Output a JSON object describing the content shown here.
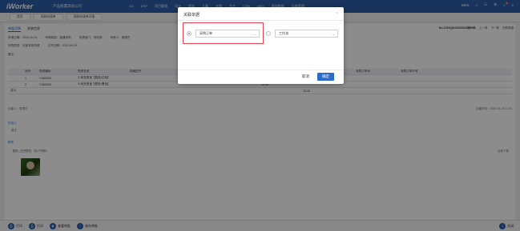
{
  "app": {
    "logo": "iWorker",
    "brand": "产品部署测试公司",
    "nav": [
      "OA",
      "ERP",
      "项目管理",
      "设计",
      "财务",
      "人事",
      "仓储",
      "生产",
      "CRM",
      "MES",
      "基础数据",
      "运维管理"
    ],
    "user": "MKS",
    "notif_count": "8"
  },
  "tabs": [
    "首页",
    "采购申请单",
    "采购申请单详情"
  ],
  "page": {
    "subtab_active": "单据详情",
    "subtab_other": "关联信息",
    "doc_no": "No.CGSQD202006250001",
    "tools": [
      "第一条",
      "上一条",
      "下一条",
      "关联单据"
    ],
    "form_rows": [
      [
        "申请日期：2020-06-25",
        "申请类型：普通采购",
        "申请部门：采购部",
        "申请人：管理员"
      ],
      [
        "采购类型：标准采购申请",
        "交货日期：2020-06-25"
      ],
      [
        "备注："
      ]
    ],
    "table": {
      "headers": [
        "",
        "序号",
        "物资编码",
        "物资名称",
        "规格型号",
        "数量",
        "单位",
        "备注",
        "采购订单号",
        "采购订单行号"
      ],
      "rows": [
        [
          "",
          "1",
          "CG60001",
          "小米充电宝【颜色:红色】",
          "",
          "",
          "5.00",
          "",
          "",
          ""
        ],
        [
          "",
          "2",
          "CG60002",
          "小米充电宝【颜色:黑色】",
          "",
          "",
          "10.00",
          "",
          "",
          ""
        ]
      ],
      "total_label": "合计",
      "total_value": "15.00"
    },
    "created": "创建人：管理员",
    "created_time": "创建时间：2020-06-25 11:00",
    "cc_label": "抄送人",
    "cc_value": "暂无",
    "attach_label": "附件",
    "attach_line": "图片【已附件】 共1个附件",
    "attach_right": "全部下载"
  },
  "bottom": {
    "items": [
      "打印",
      "打印",
      "查看审批",
      "催办审批"
    ],
    "right": "关闭"
  },
  "dialog": {
    "title": "关联单据",
    "close_glyph": "×",
    "option1": "采购订单",
    "option2": "工作流",
    "cancel": "取消",
    "ok": "确定"
  }
}
